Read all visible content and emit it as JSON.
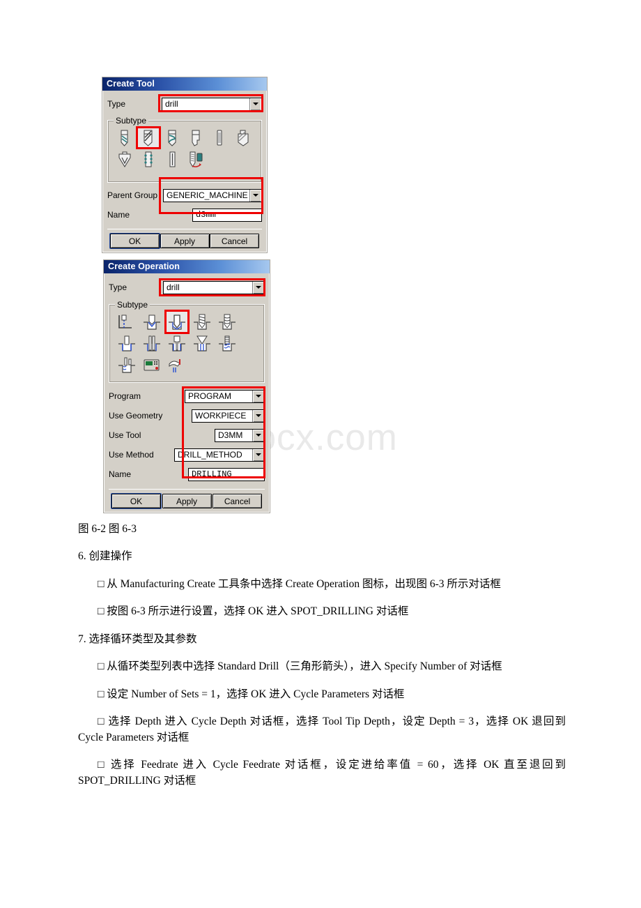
{
  "watermark": "www.bdocx.com",
  "dialog_create_tool": {
    "title": "Create Tool",
    "type_label": "Type",
    "type_value": "drill",
    "subtype_label": "Subtype",
    "subtype_icons": [
      {
        "name": "twist-drill-icon",
        "selected": false
      },
      {
        "name": "standard-drill-icon",
        "selected": true
      },
      {
        "name": "spiral-drill-icon",
        "selected": false
      },
      {
        "name": "step-drill-icon",
        "selected": false
      },
      {
        "name": "reamer-icon",
        "selected": false
      },
      {
        "name": "counterbore-drill-icon",
        "selected": false
      },
      {
        "name": "countersink-icon",
        "selected": false
      },
      {
        "name": "thread-mill-icon",
        "selected": false
      },
      {
        "name": "boring-bar-icon",
        "selected": false
      },
      {
        "name": "tap-icon",
        "selected": false
      }
    ],
    "parent_group_label": "Parent Group",
    "parent_group_value": "GENERIC_MACHINE",
    "name_label": "Name",
    "name_value": "d3mm",
    "buttons": [
      "OK",
      "Apply",
      "Cancel"
    ]
  },
  "dialog_create_operation": {
    "title": "Create Operation",
    "type_label": "Type",
    "type_value": "drill",
    "subtype_label": "Subtype",
    "subtype_icons": [
      {
        "name": "spot-facing-icon",
        "selected": false
      },
      {
        "name": "spot-drilling-icon",
        "selected": false
      },
      {
        "name": "drilling-icon",
        "selected": true
      },
      {
        "name": "peck-drilling-icon",
        "selected": false
      },
      {
        "name": "breakchip-drilling-icon",
        "selected": false
      },
      {
        "name": "boring-icon",
        "selected": false
      },
      {
        "name": "reaming-icon",
        "selected": false
      },
      {
        "name": "counterboring-icon",
        "selected": false
      },
      {
        "name": "countersinking-icon",
        "selected": false
      },
      {
        "name": "tapping-icon",
        "selected": false
      },
      {
        "name": "hole-milling-icon",
        "selected": false
      },
      {
        "name": "machine-control-icon",
        "selected": false
      },
      {
        "name": "user-defined-icon",
        "selected": false
      }
    ],
    "fields": [
      {
        "label": "Program",
        "value": "PROGRAM",
        "kind": "combo",
        "name": "program-combo"
      },
      {
        "label": "Use Geometry",
        "value": "WORKPIECE",
        "kind": "combo",
        "name": "use-geometry-combo"
      },
      {
        "label": "Use Tool",
        "value": "D3MM",
        "kind": "combo",
        "name": "use-tool-combo"
      },
      {
        "label": "Use Method",
        "value": "DRILL_METHOD",
        "kind": "combo",
        "name": "use-method-combo"
      },
      {
        "label": "Name",
        "value": "DRILLING",
        "kind": "text",
        "name": "operation-name-field"
      }
    ],
    "buttons": [
      "OK",
      "Apply",
      "Cancel"
    ]
  },
  "document": {
    "caption": "图 6-2 图 6-3",
    "heading_6": "6. 创建操作",
    "para_1": "□ 从 Manufacturing Create 工具条中选择 Create Operation 图标，出现图 6-3 所示对话框",
    "para_2": "□ 按图 6-3 所示进行设置，选择 OK 进入 SPOT_DRILLING 对话框",
    "heading_7": "7. 选择循环类型及其参数",
    "para_3": "□ 从循环类型列表中选择 Standard Drill（三角形箭头），进入 Specify Number of 对话框",
    "para_4": "□ 设定 Number of Sets = 1，选择 OK 进入 Cycle Parameters 对话框",
    "para_5": "□ 选择 Depth 进入 Cycle Depth 对话框，选择 Tool Tip Depth，设定 Depth = 3，选择 OK 退回到 Cycle Parameters 对话框",
    "para_6": "□ 选择 Feedrate 进入 Cycle Feedrate 对话框，设定进给率值 = 60，选择 OK 直至退回到 SPOT_DRILLING 对话框"
  },
  "colors": {
    "dialog_face": "#d4d0c8",
    "title_start": "#0a246a",
    "title_end": "#a6c8ef",
    "highlight_red": "#ee0000",
    "watermark_grey": "#e9e9e9"
  }
}
